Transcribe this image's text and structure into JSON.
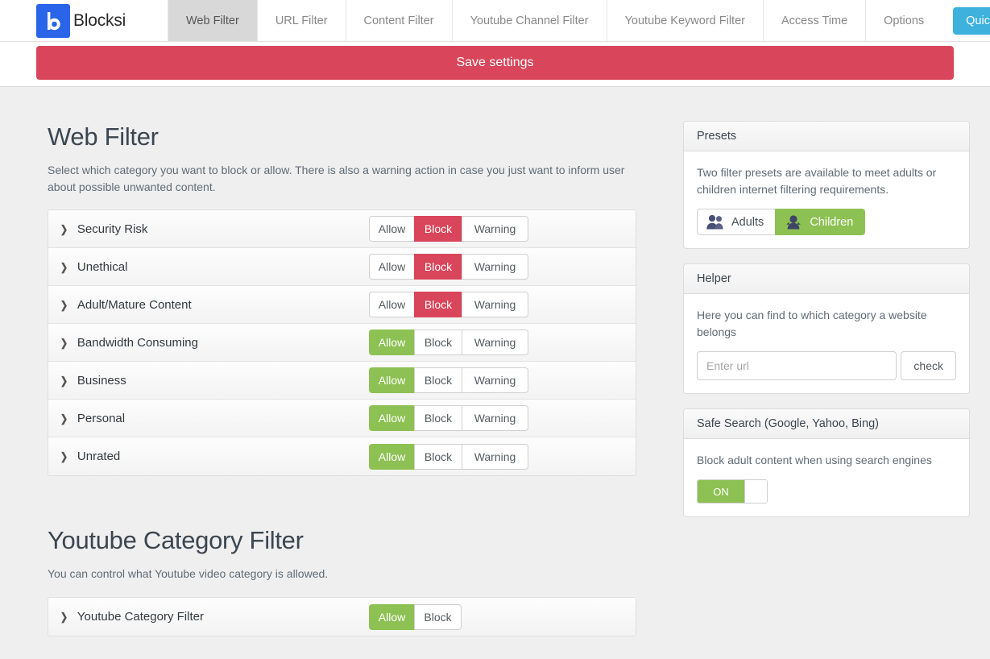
{
  "brand": {
    "name": "Blocksi",
    "logo_icon": "blocksi-b-logo-icon",
    "logo_color": "#2a64e8"
  },
  "navbar": {
    "tabs": [
      {
        "label": "Web Filter",
        "active": true
      },
      {
        "label": "URL Filter",
        "active": false
      },
      {
        "label": "Content Filter",
        "active": false
      },
      {
        "label": "Youtube Channel Filter",
        "active": false
      },
      {
        "label": "Youtube Keyword Filter",
        "active": false
      },
      {
        "label": "Access Time",
        "active": false
      },
      {
        "label": "Options",
        "active": false
      }
    ],
    "quick_setup_label": "Quick setup",
    "quick_setup_color": "#3eb1dd"
  },
  "save_bar": {
    "label": "Save settings",
    "color": "#d9455a"
  },
  "web_filter": {
    "title": "Web Filter",
    "description": "Select which category you want to block or allow. There is also a warning action in case you just want to inform user about possible unwanted content.",
    "action_labels": {
      "allow": "Allow",
      "block": "Block",
      "warning": "Warning"
    },
    "expand_icon": "chevron-right-icon",
    "categories": [
      {
        "name": "Security Risk",
        "selected": "block"
      },
      {
        "name": "Unethical",
        "selected": "block"
      },
      {
        "name": "Adult/Mature Content",
        "selected": "block"
      },
      {
        "name": "Bandwidth Consuming",
        "selected": "allow"
      },
      {
        "name": "Business",
        "selected": "allow"
      },
      {
        "name": "Personal",
        "selected": "allow"
      },
      {
        "name": "Unrated",
        "selected": "allow"
      }
    ]
  },
  "youtube_filter": {
    "title": "Youtube Category Filter",
    "description": "You can control what Youtube video category is allowed.",
    "row_label": "Youtube Category Filter",
    "action_labels": {
      "allow": "Allow",
      "block": "Block"
    },
    "selected": "allow"
  },
  "presets_panel": {
    "title": "Presets",
    "description": "Two filter presets are available to meet adults or children internet filtering requirements.",
    "adults_label": "Adults",
    "adults_icon": "two-adults-icon",
    "children_label": "Children",
    "children_icon": "child-icon",
    "selected": "children",
    "active_color": "#8dc153"
  },
  "helper_panel": {
    "title": "Helper",
    "description": "Here you can find to which category a website belongs",
    "url_value": "",
    "url_placeholder": "Enter url",
    "check_label": "check"
  },
  "safe_search_panel": {
    "title": "Safe Search (Google, Yahoo, Bing)",
    "description": "Block adult content when using search engines",
    "toggle_label": "ON",
    "toggle_state": "on",
    "toggle_color": "#8dc153"
  }
}
